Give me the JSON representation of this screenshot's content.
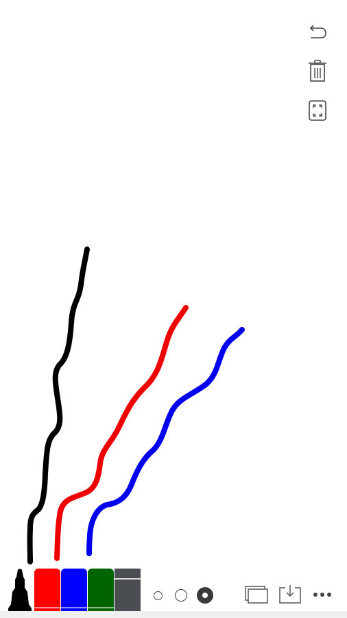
{
  "canvas": {
    "strokes": [
      {
        "name": "black-stroke",
        "color": "#000000"
      },
      {
        "name": "red-stroke",
        "color": "#ee0000"
      },
      {
        "name": "blue-stroke",
        "color": "#0000ee"
      }
    ]
  },
  "side_toolbar": {
    "icons": [
      "undo-icon",
      "trash-icon",
      "fullscreen-icon"
    ]
  },
  "toolbar": {
    "pen_icon": "marker-pen-icon",
    "colors": [
      {
        "name": "red",
        "hex": "#ff0000"
      },
      {
        "name": "blue",
        "hex": "#0000ff"
      },
      {
        "name": "green",
        "hex": "#006400"
      },
      {
        "name": "dark-gray",
        "hex": "#4a4e52"
      }
    ],
    "sizes": [
      "small",
      "medium",
      "large"
    ],
    "selected_size": "large",
    "actions": [
      "background-pages-icon",
      "save-download-icon",
      "more-icon"
    ]
  }
}
